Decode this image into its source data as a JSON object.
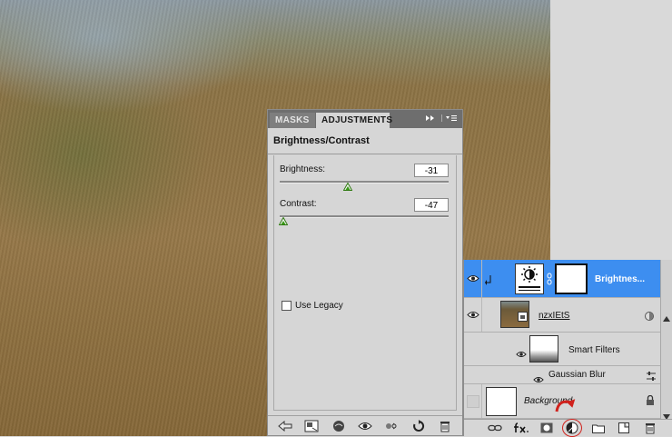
{
  "tabs": [
    {
      "label": "MASKS"
    },
    {
      "label": "ADJUSTMENTS"
    }
  ],
  "adjustment": {
    "title": "Brightness/Contrast",
    "brightness": {
      "label": "Brightness:",
      "value": "-31",
      "level": -31,
      "range": [
        -150,
        150
      ]
    },
    "contrast": {
      "label": "Contrast:",
      "value": "-47",
      "level": -47,
      "range": [
        -50,
        100
      ]
    },
    "legacy_label": "Use Legacy"
  },
  "layers": [
    {
      "name": "Brightnes...",
      "selected": true,
      "visible": true
    },
    {
      "name": "nzxIEtS",
      "visible": true
    },
    {
      "name": "Smart Filters",
      "visible": true
    },
    {
      "name": "Gaussian Blur",
      "visible": true
    },
    {
      "name": "Background",
      "visible": false
    }
  ],
  "colors": {
    "selection": "#3d8ef0",
    "panel": "#d6d6d6",
    "highlight_arrow": "#d0211c"
  },
  "icons": {
    "adj_bottom": [
      "back-arrow-icon",
      "expand-view-icon",
      "clip-layer-icon",
      "visibility-eye-icon",
      "view-previous-icon",
      "reset-icon",
      "trash-icon"
    ],
    "layers_bottom": [
      "link-icon",
      "fx-icon",
      "mask-icon",
      "adjustment-layer-icon",
      "group-folder-icon",
      "new-layer-icon",
      "trash-icon"
    ]
  }
}
